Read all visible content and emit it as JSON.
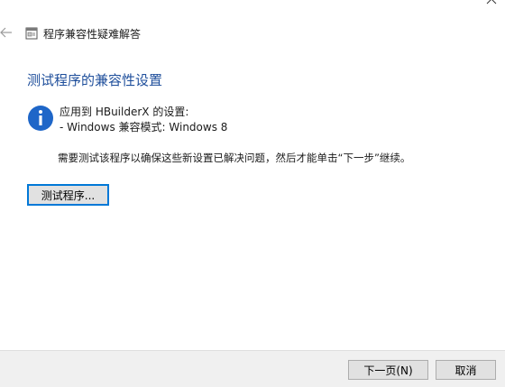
{
  "window": {
    "title": "程序兼容性疑难解答",
    "title_icon": "wizard-app-icon",
    "back_icon": "back-arrow-icon",
    "close_icon": "close-icon"
  },
  "main": {
    "heading": "测试程序的兼容性设置",
    "info_icon": "info-icon",
    "settings_applied_line": "应用到 HBuilderX 的设置:",
    "compat_mode_line": "- Windows 兼容模式: Windows 8",
    "instruction": "需要测试该程序以确保这些新设置已解决问题，然后才能单击“下一步”继续。",
    "test_button_label": "测试程序..."
  },
  "footer": {
    "next_button_label": "下一页(N)",
    "cancel_button_label": "取消"
  },
  "colors": {
    "heading": "#1e4e9b",
    "info_icon_fill": "#1e66c8",
    "focus_border": "#0078d7",
    "footer_bg": "#f0f0f0",
    "button_bg": "#e1e1e1"
  }
}
